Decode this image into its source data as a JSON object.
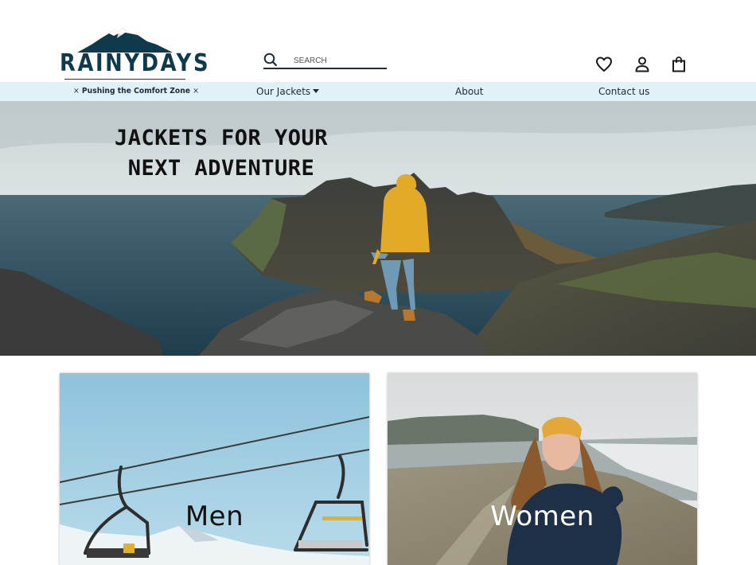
{
  "brand": {
    "name": "RAINYDAYS"
  },
  "search": {
    "placeholder": "SEARCH"
  },
  "header_icons": [
    "heart-icon",
    "user-icon",
    "shopping-bag-icon"
  ],
  "nav": {
    "tagline": "Pushing the Comfort Zone",
    "tagline_mark": "×",
    "links": [
      {
        "label": "Our Jackets",
        "has_dropdown": true
      },
      {
        "label": "About"
      },
      {
        "label": "Contact us"
      }
    ]
  },
  "hero": {
    "title_line1": "JACKETS FOR YOUR",
    "title_line2": "NEXT ADVENTURE"
  },
  "categories": [
    {
      "label": "Men"
    },
    {
      "label": "Women"
    }
  ],
  "colors": {
    "brand_navy": "#0f3a4c",
    "nav_background": "#dff2f8",
    "text_dark": "#1a2b3a"
  }
}
